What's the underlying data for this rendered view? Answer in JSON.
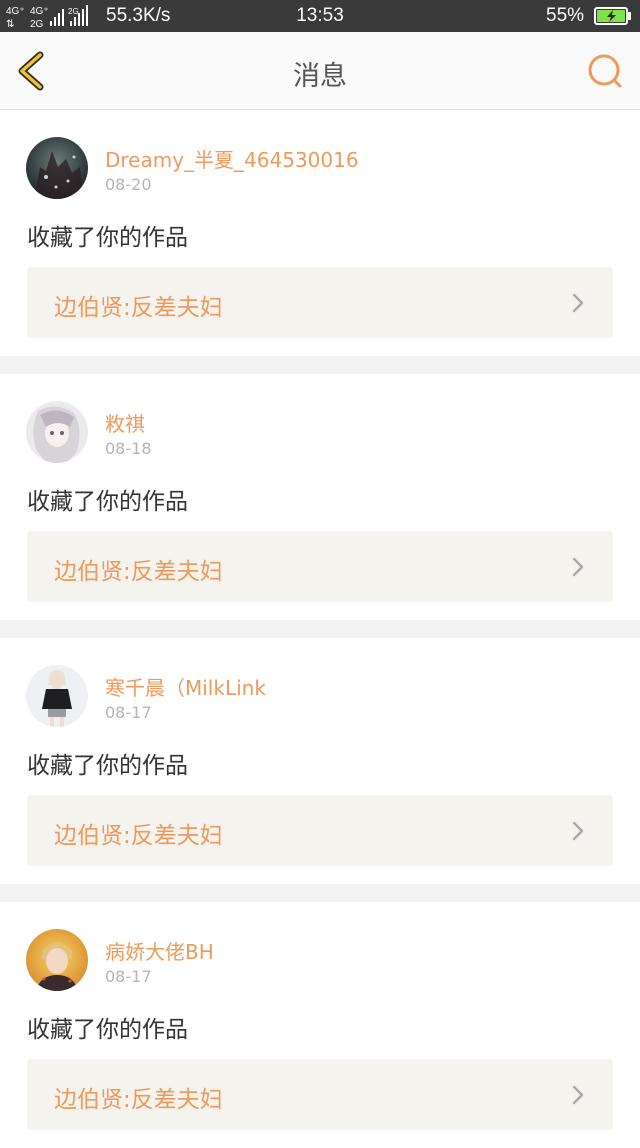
{
  "status_bar": {
    "network_left": "4G⁺",
    "network_right": "4G⁺",
    "network_small": "2G",
    "speed": "55.3K/s",
    "time": "13:53",
    "battery": "55%"
  },
  "navbar": {
    "title": "消息",
    "back_icon": "chevron-left-icon",
    "search_icon": "search-icon"
  },
  "colors": {
    "accent": "#ee9a5c",
    "back_icon": "#f0c22b",
    "battery_fill": "#7fe04a"
  },
  "messages": [
    {
      "username": "Dreamy_半夏_464530016",
      "date": "08-20",
      "action": "收藏了你的作品",
      "work_title": "边伯贤:反差夫妇"
    },
    {
      "username": "敉祺",
      "date": "08-18",
      "action": "收藏了你的作品",
      "work_title": "边伯贤:反差夫妇"
    },
    {
      "username": "寒千晨（MilkLink",
      "date": "08-17",
      "action": "收藏了你的作品",
      "work_title": "边伯贤:反差夫妇"
    },
    {
      "username": "病娇大佬BH",
      "date": "08-17",
      "action": "收藏了你的作品",
      "work_title": "边伯贤:反差夫妇"
    }
  ]
}
